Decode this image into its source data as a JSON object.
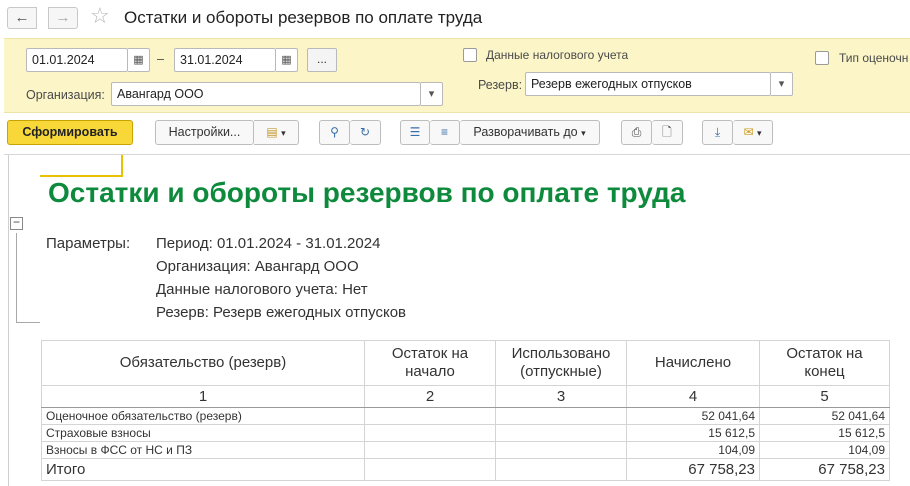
{
  "window": {
    "title": "Остатки и обороты резервов по оплате труда",
    "back_icon": "←",
    "forward_icon": "→",
    "favorite_icon": "☆"
  },
  "params": {
    "date_from": "01.01.2024",
    "date_to": "31.01.2024",
    "dash": "–",
    "dots": "...",
    "org_label": "Организация:",
    "org_value": "Авангард ООО",
    "tax_data_label": "Данные налогового учета",
    "reserve_label": "Резерв:",
    "reserve_value": "Резерв ежегодных отпусков",
    "type_label": "Тип оценочн"
  },
  "toolbar": {
    "generate": "Сформировать",
    "settings": "Настройки...",
    "expand": "Разворачивать до"
  },
  "report": {
    "title": "Остатки и обороты резервов по оплате труда",
    "params_label": "Параметры:",
    "param_lines": [
      "Период: 01.01.2024 - 31.01.2024",
      "Организация: Авангард ООО",
      "Данные налогового учета: Нет",
      "Резерв: Резерв ежегодных отпусков"
    ],
    "columns": [
      "Обязательство (резерв)",
      "Остаток на начало",
      "Использовано (отпускные)",
      "Начислено",
      "Остаток на конец"
    ],
    "column_numbers": [
      "1",
      "2",
      "3",
      "4",
      "5"
    ],
    "rows": [
      {
        "name": "Оценочное обязательство (резерв)",
        "start": "",
        "used": "",
        "accrued": "52 041,64",
        "end": "52 041,64"
      },
      {
        "name": "Страховые взносы",
        "start": "",
        "used": "",
        "accrued": "15 612,5",
        "end": "15 612,5"
      },
      {
        "name": "Взносы в ФСС от НС и ПЗ",
        "start": "",
        "used": "",
        "accrued": "104,09",
        "end": "104,09"
      }
    ],
    "total": {
      "name": "Итого",
      "start": "",
      "used": "",
      "accrued": "67 758,23",
      "end": "67 758,23"
    }
  }
}
